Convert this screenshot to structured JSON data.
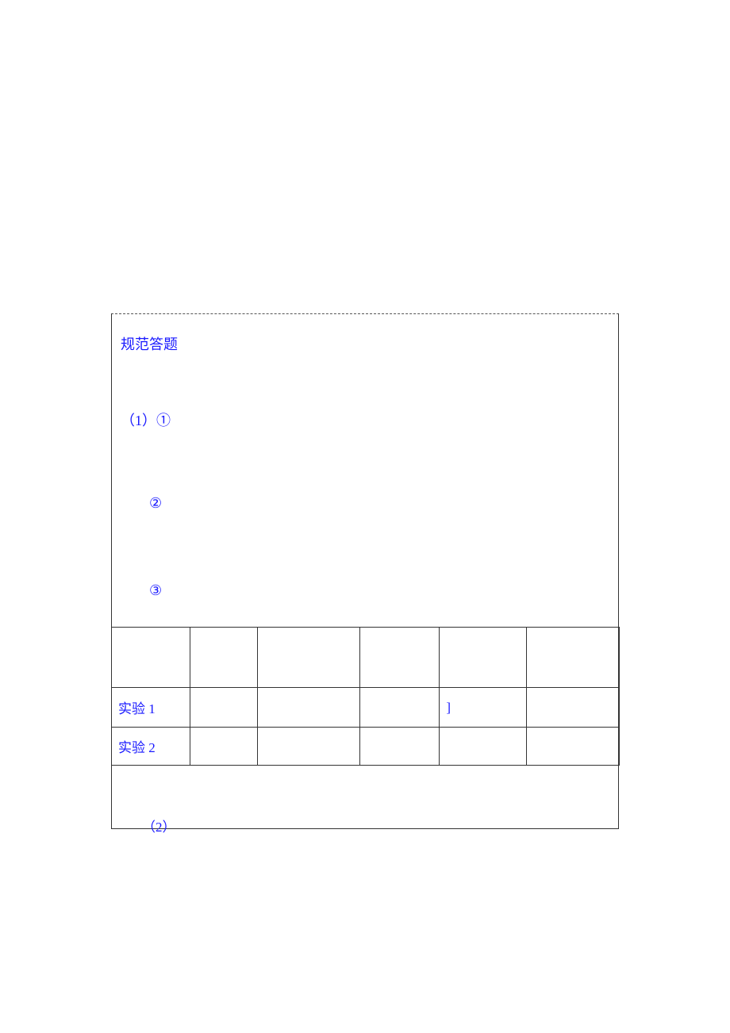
{
  "heading": "规范答题",
  "items": {
    "one": "（1）①",
    "two": "②",
    "three": "③"
  },
  "table": {
    "rows": [
      [
        "",
        "",
        "",
        "",
        "",
        ""
      ],
      [
        "实验 1",
        "",
        "",
        "",
        "]",
        ""
      ],
      [
        "实验 2",
        "",
        "",
        "",
        "",
        ""
      ]
    ]
  },
  "partial": "（2）"
}
